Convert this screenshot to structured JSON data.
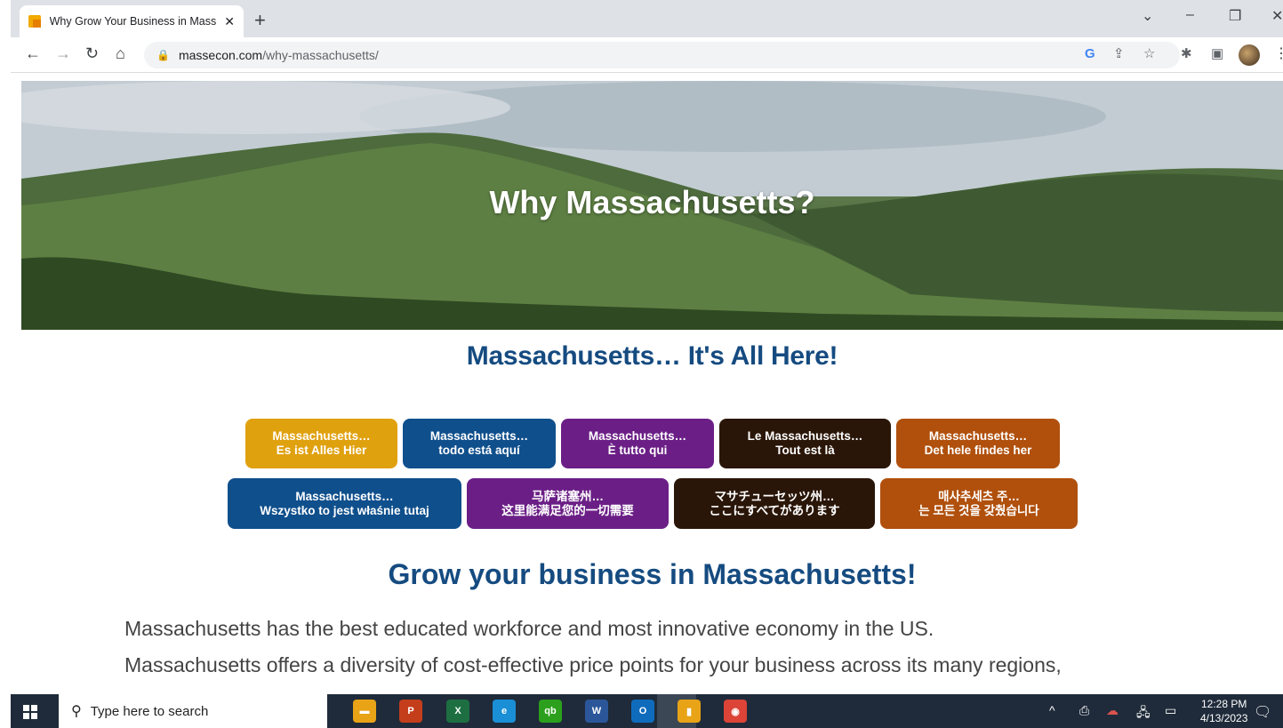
{
  "browser": {
    "tab_title": "Why Grow Your Business in Mass",
    "tab_close": "✕",
    "new_tab": "+",
    "url_host": "massecon.com",
    "url_path": "/why-massachusetts/"
  },
  "page": {
    "hero_title": "Why Massachusetts?",
    "subheading": "Massachusetts… It's All Here!",
    "lang_buttons": [
      {
        "line1": "Massachusetts…",
        "line2": "Es ist Alles Hier",
        "color": "#e0a10f"
      },
      {
        "line1": "Massachusetts…",
        "line2": "todo está aquí",
        "color": "#0f4f8c"
      },
      {
        "line1": "Massachusetts…",
        "line2": "È tutto qui",
        "color": "#6b1f86"
      },
      {
        "line1": "Le Massachusetts…",
        "line2": "Tout est là",
        "color": "#2a1608"
      },
      {
        "line1": "Massachusetts…",
        "line2": "Det hele findes her",
        "color": "#b0500c"
      },
      {
        "line1": "Massachusetts…",
        "line2": "Wszystko to jest właśnie tutaj",
        "color": "#0f4f8c"
      },
      {
        "line1": "马萨诸塞州…",
        "line2": "这里能满足您的一切需要",
        "color": "#6b1f86"
      },
      {
        "line1": "マサチューセッツ州…",
        "line2": "ここにすべてがあります",
        "color": "#2a1608"
      },
      {
        "line1": "매사추세츠 주…",
        "line2": "는 모든 것을 갖췄습니다",
        "color": "#b0500c"
      }
    ],
    "grow_heading": "Grow your business in Massachusetts!",
    "paragraph_lines": [
      "Massachusetts has the best educated workforce and most innovative economy in the US.",
      "Massachusetts offers a diversity of cost-effective price points for your business across its many regions,"
    ]
  },
  "taskbar": {
    "search_placeholder": "Type here to search",
    "time": "12:28 PM",
    "date": "4/13/2023",
    "apps": [
      {
        "name": "file-explorer-icon",
        "color": "#e8a317",
        "glyph": "▬"
      },
      {
        "name": "powerpoint-icon",
        "color": "#c43e1c",
        "glyph": "P"
      },
      {
        "name": "excel-icon",
        "color": "#1d6f42",
        "glyph": "X"
      },
      {
        "name": "edge-icon",
        "color": "#1a8fd6",
        "glyph": "e"
      },
      {
        "name": "quickbooks-icon",
        "color": "#2ca01c",
        "glyph": "qb"
      },
      {
        "name": "word-icon",
        "color": "#2b579a",
        "glyph": "W"
      },
      {
        "name": "outlook-icon",
        "color": "#0f6cbd",
        "glyph": "O"
      },
      {
        "name": "sticky-app-icon",
        "color": "#e8a317",
        "glyph": "▮"
      },
      {
        "name": "chrome-icon",
        "color": "#db4437",
        "glyph": "◉"
      }
    ]
  }
}
